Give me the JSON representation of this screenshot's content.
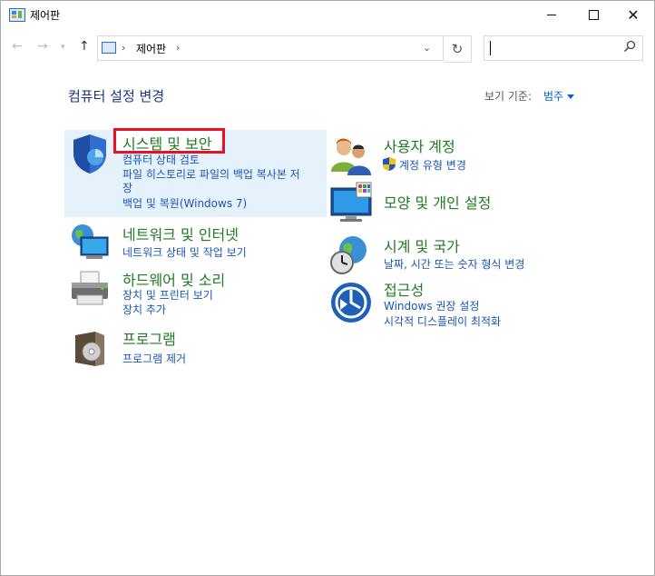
{
  "window": {
    "title": "제어판"
  },
  "nav": {
    "address": "제어판",
    "search_placeholder": ""
  },
  "content": {
    "heading": "컴퓨터 설정 변경",
    "view_by_label": "보기 기준:",
    "view_by_value": "범주"
  },
  "categories": {
    "system": {
      "title": "시스템 및 보안",
      "links": [
        "컴퓨터 상태 검토",
        "파일 히스토리로 파일의 백업 복사본 저",
        "장",
        "백업 및 복원(Windows 7)"
      ]
    },
    "network": {
      "title": "네트워크 및 인터넷",
      "links": [
        "네트워크 상태 및 작업 보기"
      ]
    },
    "hardware": {
      "title": "하드웨어 및 소리",
      "links": [
        "장치 및 프린터 보기",
        "장치 추가"
      ]
    },
    "programs": {
      "title": "프로그램",
      "links": [
        "프로그램 제거"
      ]
    },
    "users": {
      "title": "사용자 계정",
      "links": [
        "계정 유형 변경"
      ]
    },
    "appearance": {
      "title": "모양 및 개인 설정",
      "links": []
    },
    "clock": {
      "title": "시계 및 국가",
      "links": [
        "날짜, 시간 또는 숫자 형식 변경"
      ]
    },
    "ease": {
      "title": "접근성",
      "links": [
        "Windows 권장 설정",
        "시각적 디스플레이 최적화"
      ]
    }
  },
  "colors": {
    "accent_link": "#1a55b8",
    "category_title": "#217a24",
    "highlight": "#e5f1fb",
    "callout": "#e81123"
  }
}
